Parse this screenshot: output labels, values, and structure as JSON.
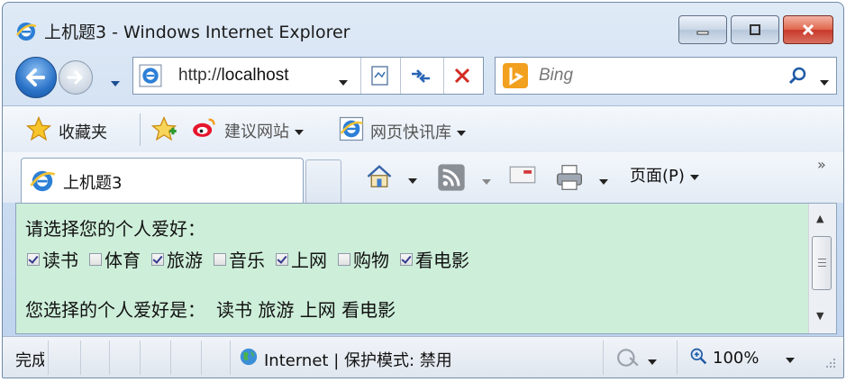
{
  "window": {
    "title": "上机题3 - Windows Internet Explorer",
    "controls": {
      "minimize": "minimize-icon",
      "maximize": "maximize-icon",
      "close": "close-icon"
    }
  },
  "address_bar": {
    "url_prefix": "http://",
    "url_host": "localhost"
  },
  "search": {
    "placeholder": "Bing"
  },
  "favorites_bar": {
    "favorites_label": "收藏夹",
    "suggested_sites": "建议网站",
    "web_slice_gallery": "网页快讯库"
  },
  "tabs": [
    {
      "label": "上机题3"
    }
  ],
  "command_bar": {
    "page_menu": "页面(P)"
  },
  "page": {
    "prompt": "请选择您的个人爱好：",
    "hobbies": [
      {
        "label": "读书",
        "checked": true
      },
      {
        "label": "体育",
        "checked": false
      },
      {
        "label": "旅游",
        "checked": true
      },
      {
        "label": "音乐",
        "checked": false
      },
      {
        "label": "上网",
        "checked": true
      },
      {
        "label": "购物",
        "checked": false
      },
      {
        "label": "看电影",
        "checked": true
      }
    ],
    "result_label": "您选择的个人爱好是：",
    "result_values": "读书 旅游 上网 看电影"
  },
  "status_bar": {
    "status_text": "完成",
    "zone": "Internet | 保护模式: 禁用",
    "zoom": "100%"
  },
  "colors": {
    "page_background": "#cdeed9",
    "close_button": "#d2452f",
    "chrome": "#c8daf0"
  }
}
